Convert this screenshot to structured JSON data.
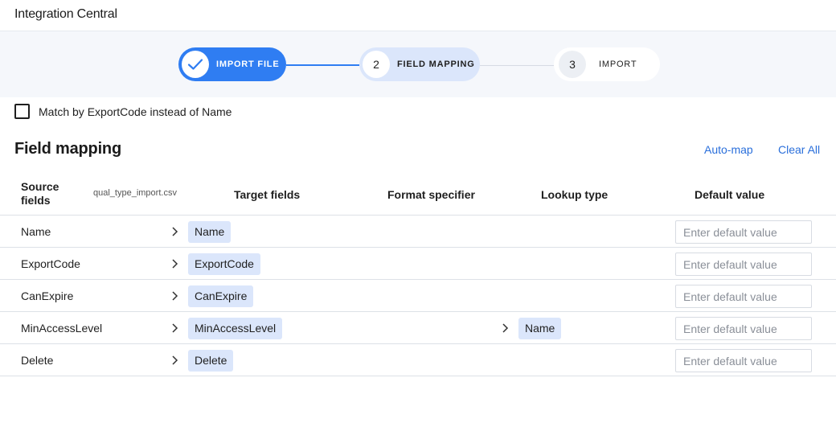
{
  "app": {
    "title": "Integration Central"
  },
  "stepper": {
    "steps": [
      {
        "number": "",
        "label": "IMPORT FILE",
        "status": "complete"
      },
      {
        "number": "2",
        "label": "FIELD MAPPING",
        "status": "active"
      },
      {
        "number": "3",
        "label": "IMPORT",
        "status": "pending"
      }
    ]
  },
  "options": {
    "match_label": "Match by ExportCode instead of Name",
    "match_checked": false
  },
  "mapping": {
    "title": "Field mapping",
    "auto_map_label": "Auto-map",
    "clear_all_label": "Clear All",
    "columns": {
      "source": "Source fields",
      "file_name": "qual_type_import.csv",
      "target": "Target fields",
      "format": "Format specifier",
      "lookup": "Lookup type",
      "default": "Default value"
    },
    "rows": [
      {
        "source": "Name",
        "target": "Name",
        "lookup": "",
        "default_placeholder": "Enter default value"
      },
      {
        "source": "ExportCode",
        "target": "ExportCode",
        "lookup": "",
        "default_placeholder": "Enter default value"
      },
      {
        "source": "CanExpire",
        "target": "CanExpire",
        "lookup": "",
        "default_placeholder": "Enter default value"
      },
      {
        "source": "MinAccessLevel",
        "target": "MinAccessLevel",
        "lookup": "Name",
        "default_placeholder": "Enter default value"
      },
      {
        "source": "Delete",
        "target": "Delete",
        "lookup": "",
        "default_placeholder": "Enter default value"
      }
    ]
  },
  "colors": {
    "primary": "#2f7df2",
    "chip": "#dbe6fb",
    "link": "#2a6fdb"
  }
}
